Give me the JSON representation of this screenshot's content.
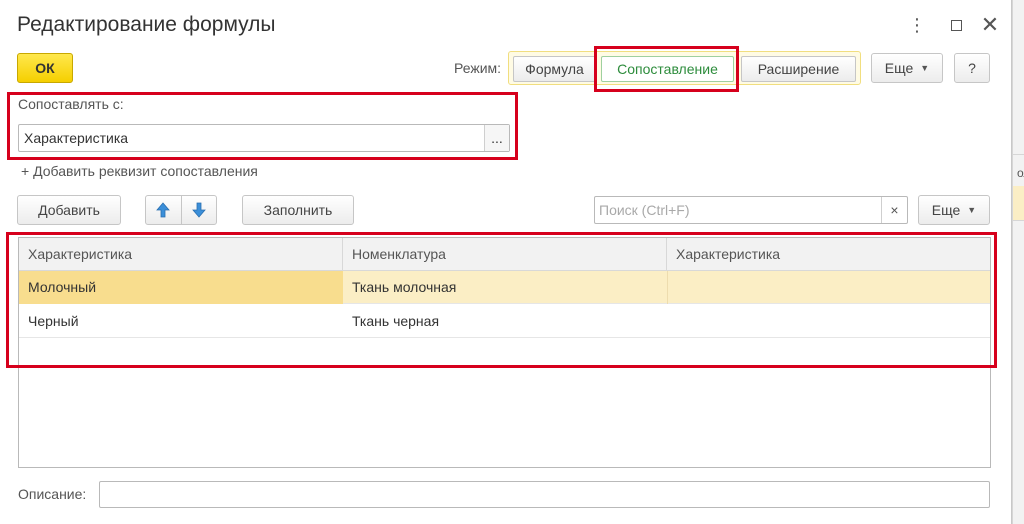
{
  "window": {
    "title": "Редактирование формулы",
    "controls": {
      "more": "⋮",
      "maximize": "□",
      "close": "✕"
    }
  },
  "toolbar": {
    "ok_label": "ОК",
    "mode_label": "Режим:",
    "modes": [
      {
        "label": "Формула",
        "active": false
      },
      {
        "label": "Сопоставление",
        "active": true
      },
      {
        "label": "Расширение",
        "active": false
      }
    ],
    "more_label": "Еще",
    "help_label": "?"
  },
  "match": {
    "label": "Сопоставлять с:",
    "value": "Характеристика",
    "select_label": "...",
    "add_link": "+ Добавить реквизит сопоставления"
  },
  "table_toolbar": {
    "add_label": "Добавить",
    "fill_label": "Заполнить",
    "search_placeholder": "Поиск (Ctrl+F)",
    "search_clear": "×",
    "more_label": "Еще"
  },
  "table": {
    "columns": [
      "Характеристика",
      "Номенклатура",
      "Характеристика"
    ],
    "rows": [
      [
        "Молочный",
        "Ткань молочная",
        ""
      ],
      [
        "Черный",
        "Ткань черная",
        ""
      ]
    ],
    "selected_row": 0
  },
  "description": {
    "label": "Описание:",
    "value": ""
  },
  "colors": {
    "ok_yellow": "#f5cf00",
    "active_mode_text": "#2d8c3c",
    "selected_row": "#fbeec5",
    "highlight_red": "#d6001c"
  }
}
